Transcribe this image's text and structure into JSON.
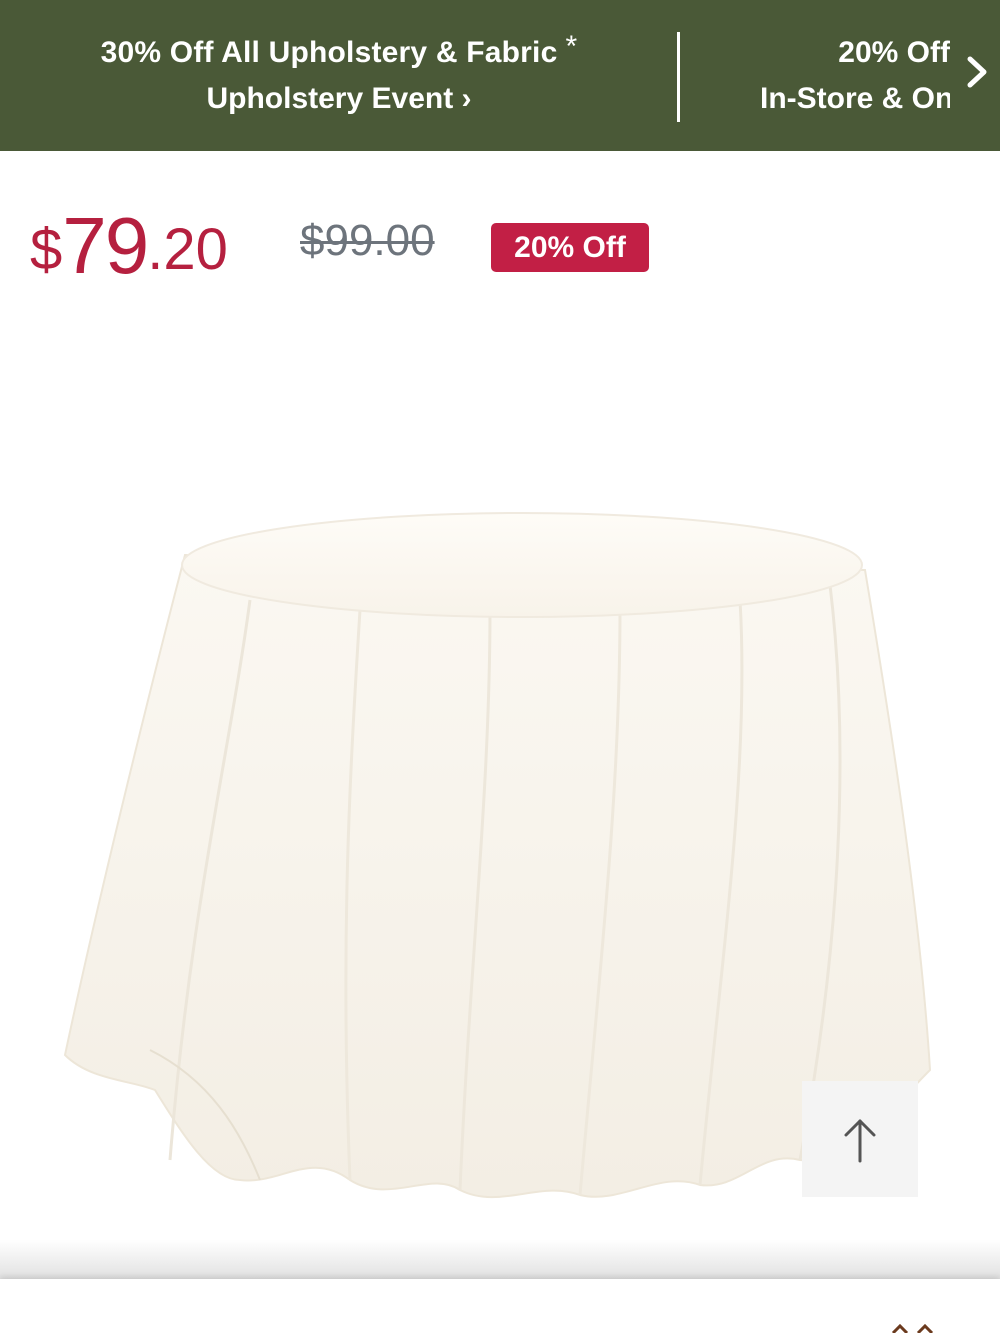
{
  "promo_bar": {
    "background": "#4a5937",
    "left": {
      "title": "30% Off All Upholstery & Fabric",
      "asterisk": "*",
      "link": "Upholstery Event ›"
    },
    "right": {
      "title": "20% Off",
      "subtitle": "In-Store & Online"
    },
    "next_icon": "chevron-right-icon"
  },
  "pricing": {
    "currency": "$",
    "current_main": "79",
    "current_cents": ".20",
    "original_price": "$99.00",
    "discount_badge": "20% Off",
    "accent": "#b5203f"
  },
  "product": {
    "image": "round white tablecloth"
  },
  "scroll_top": {
    "icon": "arrow-up-icon"
  }
}
